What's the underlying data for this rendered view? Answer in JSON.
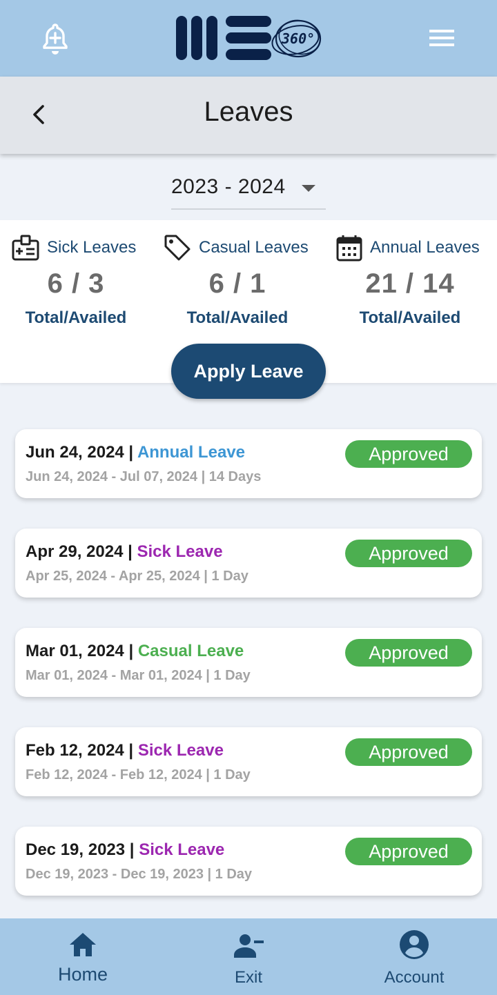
{
  "app": {
    "logo_text": "360°",
    "colors": {
      "topbar": "#a4c8e6",
      "navy": "#1c4a73",
      "approved": "#4caf50",
      "annual": "#3d96d4",
      "sick": "#9c27b0",
      "casual": "#4caf50"
    }
  },
  "header": {
    "title": "Leaves",
    "back_icon": "chevron-left-icon"
  },
  "filter": {
    "year": "2023 - 2024"
  },
  "stats": [
    {
      "label": "Sick Leaves",
      "value": "6 / 3",
      "sub": "Total/Availed",
      "icon": "medical-id-icon"
    },
    {
      "label": "Casual Leaves",
      "value": "6 / 1",
      "sub": "Total/Availed",
      "icon": "tag-icon"
    },
    {
      "label": "Annual Leaves",
      "value": "21 / 14",
      "sub": "Total/Availed",
      "icon": "calendar-icon"
    }
  ],
  "apply_button": "Apply Leave",
  "leaves": [
    {
      "date": "Jun 24, 2024",
      "sep": " | ",
      "type": "Annual Leave",
      "type_color": "#3d96d4",
      "range": "Jun 24, 2024 - Jul 07, 2024 | 14 Days",
      "status": "Approved"
    },
    {
      "date": "Apr 29, 2024",
      "sep": " | ",
      "type": "Sick Leave",
      "type_color": "#9c27b0",
      "range": "Apr 25, 2024 - Apr 25, 2024 | 1 Day",
      "status": "Approved"
    },
    {
      "date": "Mar 01, 2024",
      "sep": " | ",
      "type": "Casual Leave",
      "type_color": "#4caf50",
      "range": "Mar 01, 2024 - Mar 01, 2024 | 1 Day",
      "status": "Approved"
    },
    {
      "date": "Feb 12, 2024",
      "sep": " | ",
      "type": "Sick Leave",
      "type_color": "#9c27b0",
      "range": "Feb 12, 2024 - Feb 12, 2024 | 1 Day",
      "status": "Approved"
    },
    {
      "date": "Dec 19, 2023",
      "sep": " | ",
      "type": "Sick Leave",
      "type_color": "#9c27b0",
      "range": "Dec 19, 2023 - Dec 19, 2023 | 1 Day",
      "status": "Approved"
    }
  ],
  "bottom_nav": [
    {
      "label": "Home",
      "icon": "home-icon"
    },
    {
      "label": "Exit",
      "icon": "person-remove-icon"
    },
    {
      "label": "Account",
      "icon": "account-circle-icon"
    }
  ]
}
